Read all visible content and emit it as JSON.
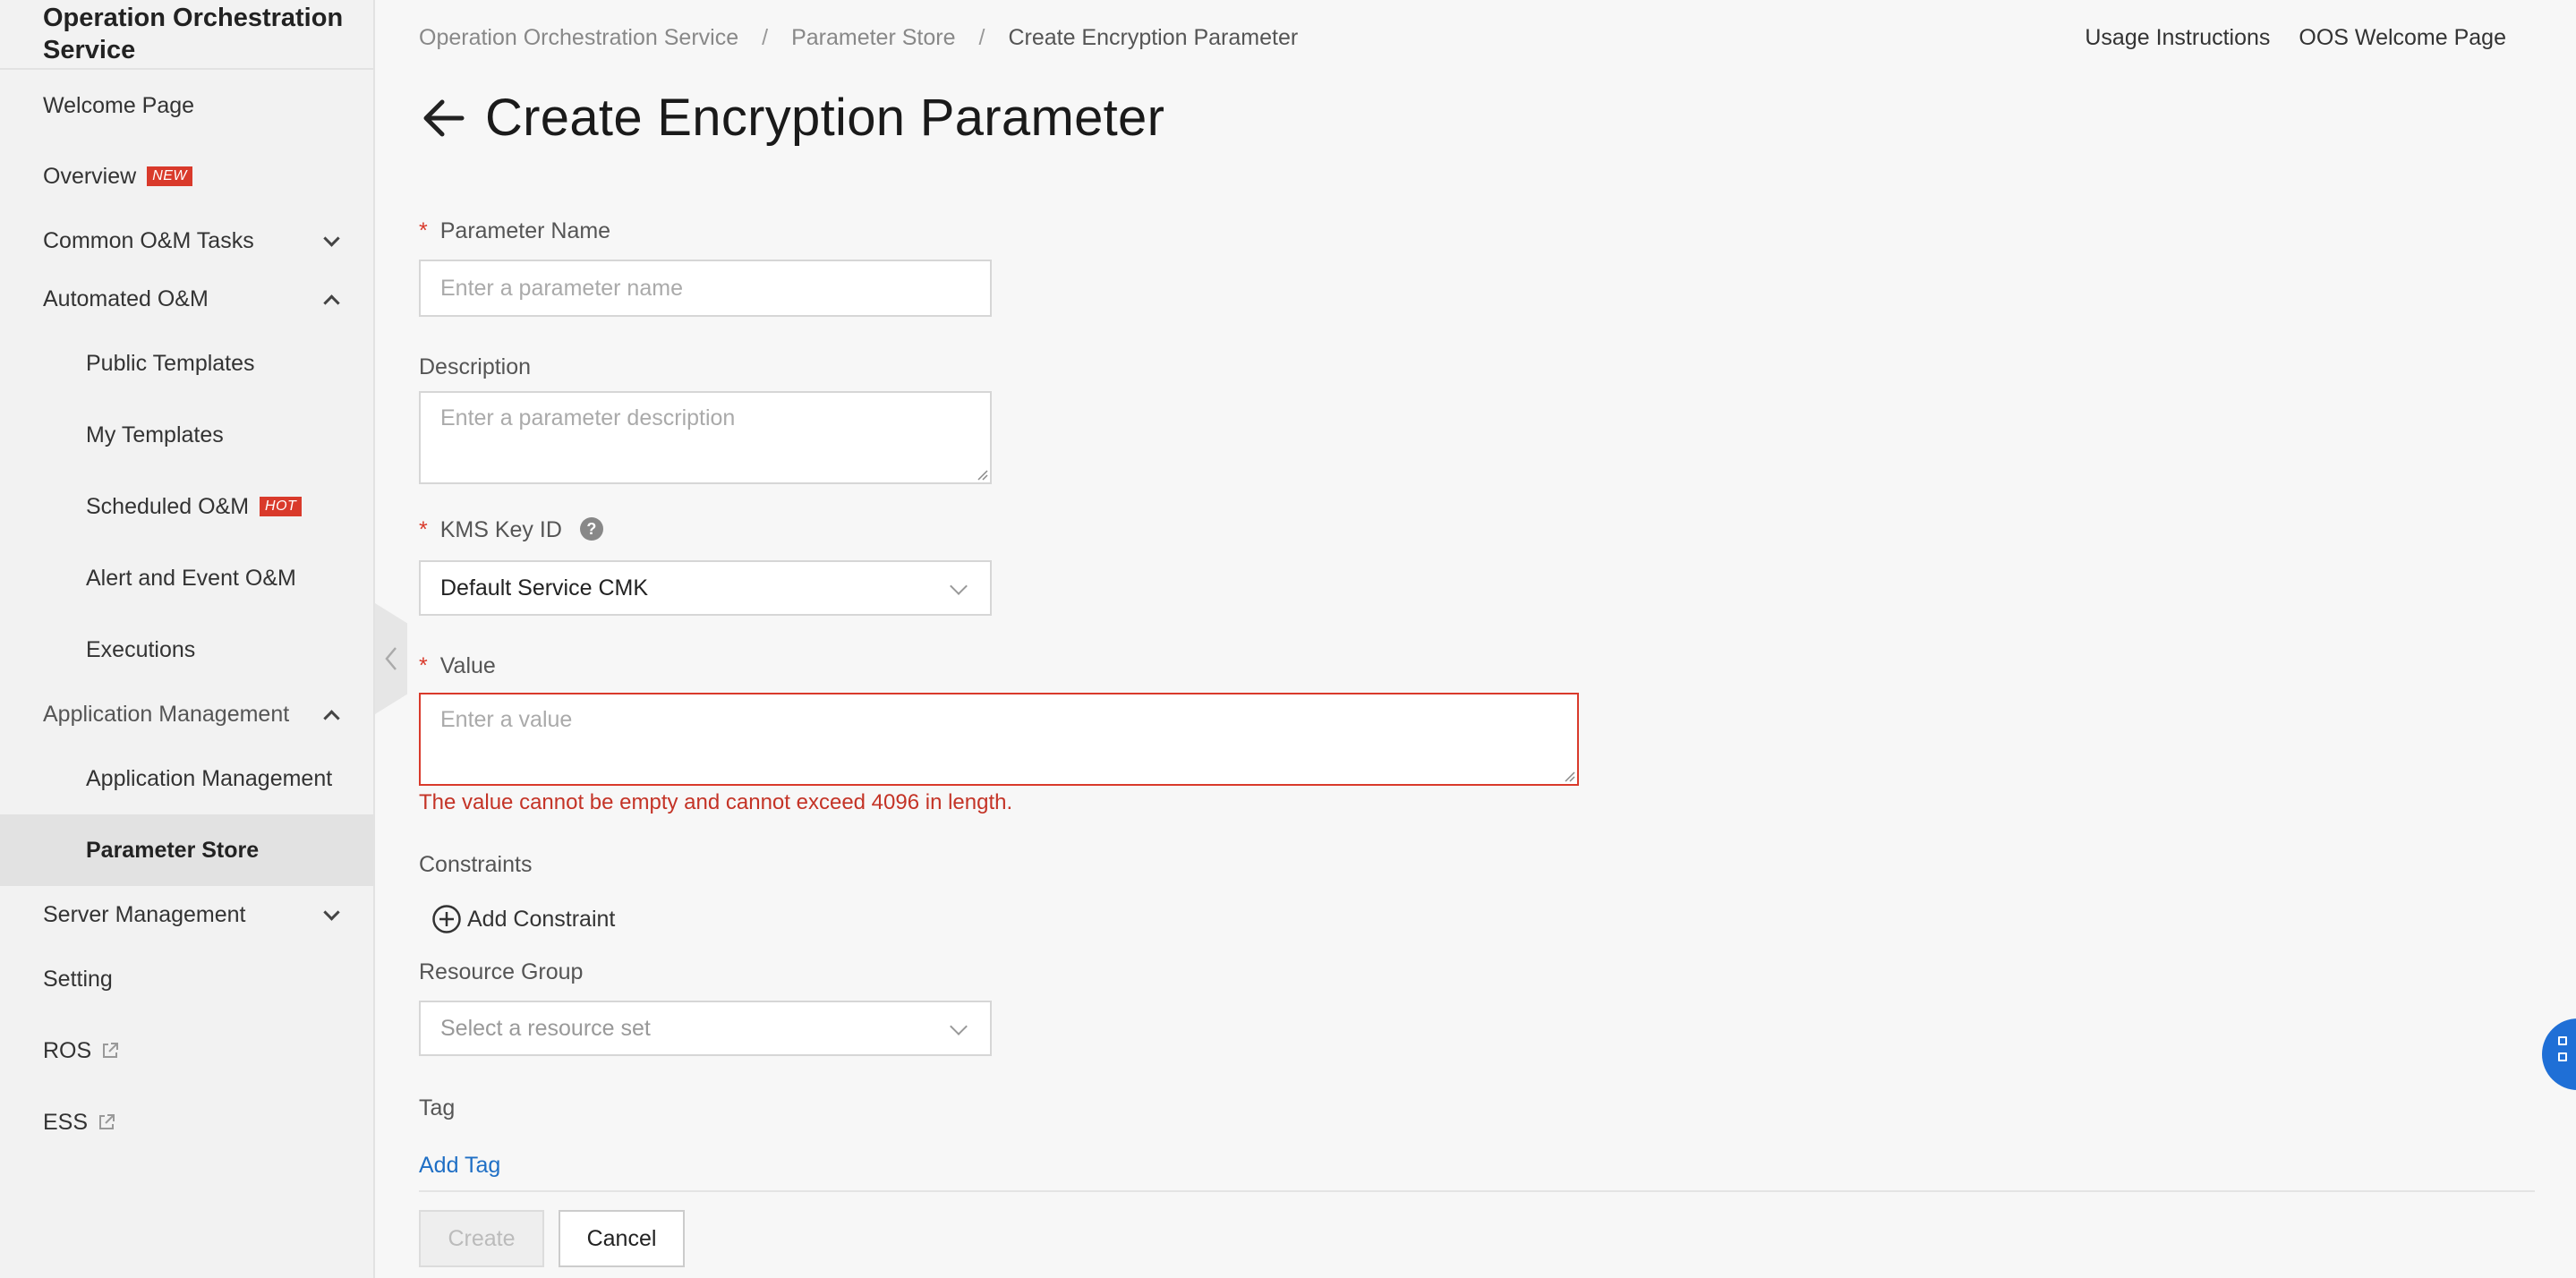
{
  "sidebar": {
    "title": "Operation Orchestration Service",
    "items": [
      {
        "label": "Welcome Page"
      },
      {
        "label": "Overview",
        "badge": "NEW"
      },
      {
        "label": "Common O&M Tasks"
      },
      {
        "label": "Automated O&M"
      },
      {
        "label": "Public Templates"
      },
      {
        "label": "My Templates"
      },
      {
        "label": "Scheduled O&M",
        "badge": "HOT"
      },
      {
        "label": "Alert and Event O&M"
      },
      {
        "label": "Executions"
      },
      {
        "label": "Application Management"
      },
      {
        "label": "Application Management"
      },
      {
        "label": "Parameter Store"
      },
      {
        "label": "Server Management"
      },
      {
        "label": "Setting"
      },
      {
        "label": "ROS"
      },
      {
        "label": "ESS"
      }
    ]
  },
  "header": {
    "breadcrumb": [
      "Operation Orchestration Service",
      "Parameter Store",
      "Create Encryption Parameter"
    ],
    "separator": "/",
    "links": [
      "Usage Instructions",
      "OOS Welcome Page"
    ]
  },
  "page": {
    "title": "Create Encryption Parameter"
  },
  "form": {
    "required_mark": "*",
    "name": {
      "label": "Parameter Name",
      "placeholder": "Enter a parameter name"
    },
    "description": {
      "label": "Description",
      "placeholder": "Enter a parameter description"
    },
    "kms": {
      "label": "KMS Key ID",
      "help": "?",
      "value": "Default Service CMK"
    },
    "value": {
      "label": "Value",
      "placeholder": "Enter a value",
      "error": "The value cannot be empty and cannot exceed 4096 in length."
    },
    "constraints": {
      "label": "Constraints",
      "add_label": "Add Constraint"
    },
    "resource_group": {
      "label": "Resource Group",
      "placeholder": "Select a resource set"
    },
    "tag": {
      "label": "Tag",
      "add_label": "Add Tag"
    }
  },
  "actions": {
    "create": "Create",
    "cancel": "Cancel"
  },
  "colors": {
    "error": "#d93a2b",
    "link": "#1f6fc5",
    "float_button": "#1f6fd6"
  }
}
